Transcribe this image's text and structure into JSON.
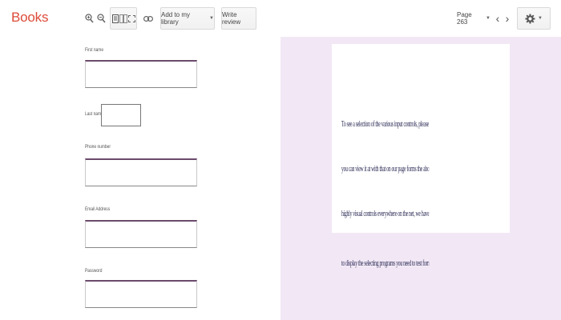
{
  "app": {
    "brand": "Books"
  },
  "toolbar": {
    "zoom_in_icon": "zoom-in-icon",
    "zoom_out_icon": "zoom-out-icon",
    "add_to_library_label": "Add to my library",
    "write_review_label": "Write review",
    "page_label": "Page 263"
  },
  "form": {
    "first_name_label": "First name",
    "last_name_label": "Last name",
    "phone_label": "Phone number",
    "email_label": "Email Address",
    "password_label": "Password"
  },
  "preview": {
    "lines": [
      "To see a selection of the various input controls, please visit Google's forms and styling",
      "you can view it at with that on our page forms the above and the figures they select",
      "highly visual controls everywhere on the net, we have the labels in inputs and figures",
      "to display the selecting programs you need to test forms the label formats."
    ]
  },
  "colors": {
    "brand": "#dd4b39",
    "viewer_bg": "#f2e8f5",
    "input_border_top": "#6b4a6b"
  }
}
